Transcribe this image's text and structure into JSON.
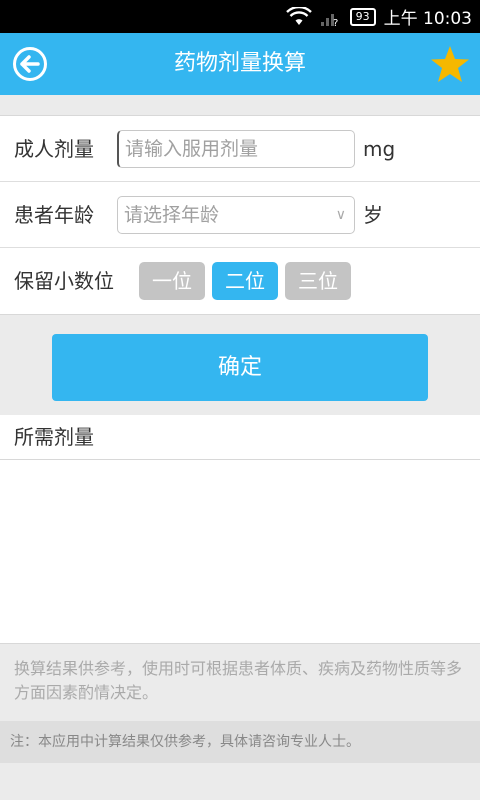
{
  "status_bar": {
    "battery": "93",
    "time": "上午 10:03"
  },
  "header": {
    "title": "药物剂量换算",
    "back_icon": "back-arrow-circle-icon",
    "favorite_icon": "star-icon",
    "accent_color": "#34b6f0",
    "star_color": "#f5b800"
  },
  "form": {
    "dose": {
      "label": "成人剂量",
      "placeholder": "请输入服用剂量",
      "unit": "mg"
    },
    "age": {
      "label": "患者年龄",
      "placeholder": "请选择年龄",
      "unit": "岁"
    },
    "decimals": {
      "label": "保留小数位",
      "options": [
        "一位",
        "二位",
        "三位"
      ],
      "selected": "二位"
    }
  },
  "confirm_label": "确定",
  "result": {
    "heading": "所需剂量",
    "value": ""
  },
  "tip_text": "换算结果供参考，使用时可根据患者体质、疾病及药物性质等多方面因素酌情决定。",
  "note_text": "注：本应用中计算结果仅供参考，具体请咨询专业人士。"
}
